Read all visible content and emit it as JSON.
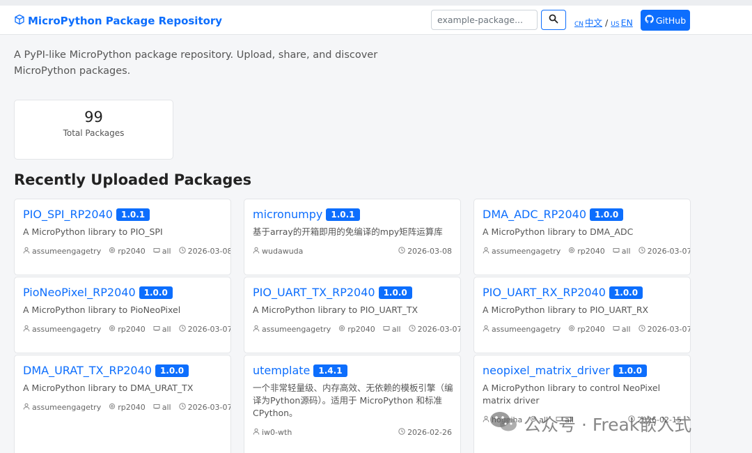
{
  "header": {
    "title": "MicroPython Package Repository",
    "search_placeholder": "example-package...",
    "lang_cn_code": "CN",
    "lang_cn": "中文",
    "lang_sep": "/",
    "lang_en_code": "US",
    "lang_en": "EN",
    "github": "GitHub"
  },
  "intro": "A PyPI-like MicroPython package repository. Upload, share, and discover MicroPython packages.",
  "stats": {
    "value": "99",
    "label": "Total Packages"
  },
  "section_title": "Recently Uploaded Packages",
  "packages": [
    {
      "name": "PIO_SPI_RP2040",
      "version": "1.0.1",
      "description": "A MicroPython library to PIO_SPI",
      "author": "assumeengagetry",
      "port": "rp2040",
      "arch": "all",
      "date": "2026-03-08"
    },
    {
      "name": "micronumpy",
      "version": "1.0.1",
      "description": "基于array的开箱即用的免编译的mpy矩阵运算库",
      "author": "wudawuda",
      "date": "2026-03-08"
    },
    {
      "name": "DMA_ADC_RP2040",
      "version": "1.0.0",
      "description": "A MicroPython library to DMA_ADC",
      "author": "assumeengagetry",
      "port": "rp2040",
      "arch": "all",
      "date": "2026-03-07"
    },
    {
      "name": "PioNeoPixel_RP2040",
      "version": "1.0.0",
      "description": "A MicroPython library to PioNeoPixel",
      "author": "assumeengagetry",
      "port": "rp2040",
      "arch": "all",
      "date": "2026-03-07"
    },
    {
      "name": "PIO_UART_TX_RP2040",
      "version": "1.0.0",
      "description": "A MicroPython library to PIO_UART_TX",
      "author": "assumeengagetry",
      "port": "rp2040",
      "arch": "all",
      "date": "2026-03-07"
    },
    {
      "name": "PIO_UART_RX_RP2040",
      "version": "1.0.0",
      "description": "A MicroPython library to PIO_UART_RX",
      "author": "assumeengagetry",
      "port": "rp2040",
      "arch": "all",
      "date": "2026-03-07"
    },
    {
      "name": "DMA_URAT_TX_RP2040",
      "version": "1.0.0",
      "description": "A MicroPython library to DMA_URAT_TX",
      "author": "assumeengagetry",
      "port": "rp2040",
      "arch": "all",
      "date": "2026-03-07"
    },
    {
      "name": "utemplate",
      "version": "1.4.1",
      "description": "一个非常轻量级、内存高效、无依赖的模板引擎（编译为Python源码）。适用于 MicroPython 和标准 CPython。",
      "author": "iw0-wth",
      "date": "2026-02-26"
    },
    {
      "name": "neopixel_matrix_driver",
      "version": "1.0.0",
      "description": "A MicroPython library to control NeoPixel matrix driver",
      "author": "hogeiha",
      "port": "all",
      "arch": "all",
      "date": "2026-02-15"
    }
  ],
  "watermark": "公众号 · Freak嵌入式",
  "colors": {
    "accent": "#0d6efd",
    "background": "#f5f6f8"
  }
}
